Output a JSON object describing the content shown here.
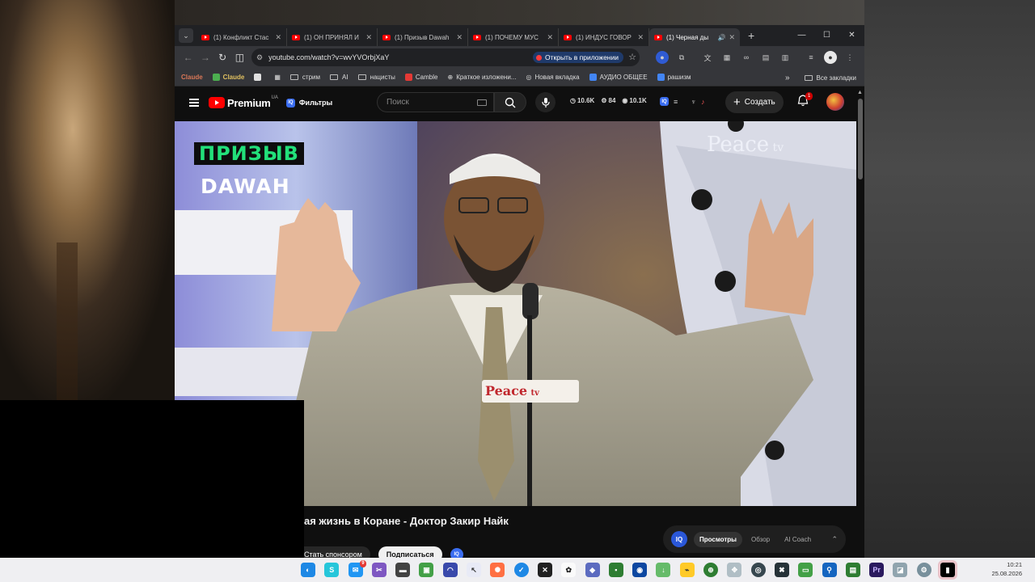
{
  "browser": {
    "tabs": [
      {
        "title": "(1) Конфликт Стас",
        "active": false
      },
      {
        "title": "(1) ОН ПРИНЯЛ И",
        "active": false
      },
      {
        "title": "(1) Призыв Dawah",
        "active": false
      },
      {
        "title": "(1) ПОЧЕМУ МУС",
        "active": false
      },
      {
        "title": "(1) ИНДУС ГОВОР",
        "active": false
      },
      {
        "title": "(1) Черная ды",
        "active": true
      }
    ],
    "url": "youtube.com/watch?v=wvYVOrbjXaY",
    "open_in_app": "Открыть в приложении",
    "bookmarks": [
      {
        "label": "Claude",
        "icon": "claude",
        "color": "#d97757"
      },
      {
        "label": "Claude",
        "icon": "claude-green",
        "color": "#4caf50"
      },
      {
        "label": "",
        "icon": "blank-page",
        "color": "#e0e0e0"
      },
      {
        "label": "",
        "icon": "apps-grid",
        "color": "#cccccc"
      },
      {
        "label": "стрим",
        "icon": "folder",
        "color": "#cccccc"
      },
      {
        "label": "AI",
        "icon": "folder",
        "color": "#cccccc"
      },
      {
        "label": "нацисты",
        "icon": "folder",
        "color": "#cccccc"
      },
      {
        "label": "Camble",
        "icon": "camble",
        "color": "#e53935"
      },
      {
        "label": "Краткое изложени...",
        "icon": "globe",
        "color": "#cccccc"
      },
      {
        "label": "Новая вкладка",
        "icon": "chrome",
        "color": "#cccccc"
      },
      {
        "label": "АУДИО ОБЩЕЕ",
        "icon": "doc",
        "color": "#4285f4"
      },
      {
        "label": "рашизм",
        "icon": "doc",
        "color": "#4285f4"
      }
    ],
    "all_bookmarks": "Все закладки"
  },
  "youtube": {
    "logo_text": "Premium",
    "region": "UA",
    "filters_label": "Фильтры",
    "filters_badge": "IQ",
    "search_placeholder": "Поиск",
    "stats": {
      "views": "10.6K",
      "comments": "84",
      "watching": "10.1K"
    },
    "create_label": "Создать",
    "notifications_count": "1",
    "video_title": "ая жизнь в Коране - Доктор Закир Найк",
    "button_left": "Стать спонсором",
    "subscribe_label": "Подписаться",
    "iq_panel": {
      "logo": "IQ",
      "tabs": [
        {
          "label": "Просмотры",
          "active": true
        },
        {
          "label": "Обзор",
          "active": false
        },
        {
          "label": "AI Coach",
          "active": false
        }
      ]
    },
    "video_overlay": {
      "channel_badge_top": "ПРИЗЫВ",
      "channel_badge_bottom": "DAWAH",
      "watermark": "Peace",
      "watermark_sub": "tv",
      "mic_logo": "Peace",
      "mic_logo_sub": "tv"
    }
  },
  "taskbar": {
    "time": "10:21",
    "date": "25.08.2026",
    "mail_badge": "9"
  }
}
